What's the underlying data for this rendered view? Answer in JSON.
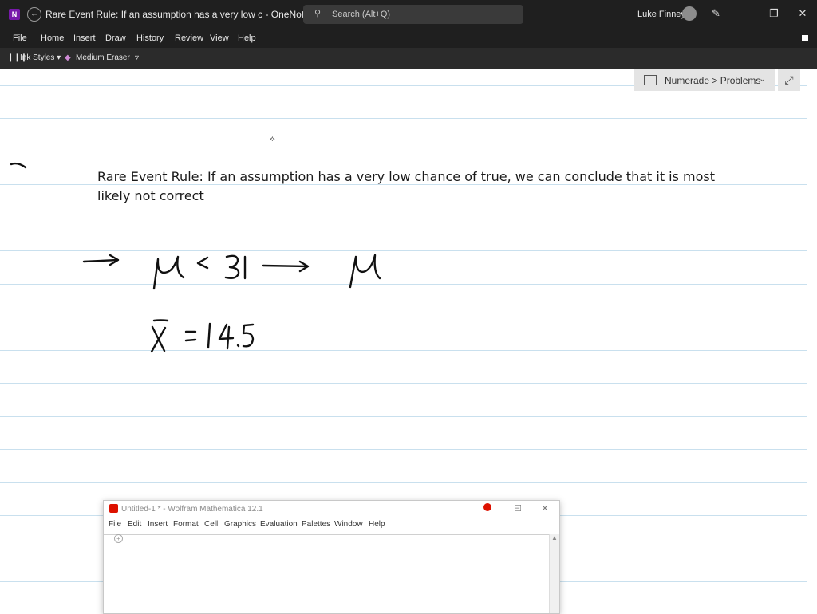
{
  "titlebar": {
    "app_logo": "N",
    "page_title": "Rare Event Rule: If an assumption has a very low c  -  OneNote",
    "search_placeholder": "Search (Alt+Q)",
    "user_name": "Luke Finney",
    "icons": [
      "onenote-icon",
      "back-icon",
      "search-icon",
      "avatar",
      "pen-icon",
      "minimize-icon",
      "restore-icon",
      "close-icon"
    ]
  },
  "menu": {
    "items": [
      "File",
      "Home",
      "Insert",
      "Draw",
      "History",
      "Review",
      "View",
      "Help"
    ]
  },
  "ribbon": {
    "ink_styles": "Ink Styles",
    "eraser": "Medium Eraser"
  },
  "notebook": {
    "breadcrumb": "Numerade > Problems"
  },
  "note": {
    "text": "Rare Event Rule: If an assumption has a very low chance of true, we can conclude that it is most likely not correct"
  },
  "mathematica": {
    "title": "Untitled-1 * - Wolfram Mathematica 12.1",
    "menu": [
      "File",
      "Edit",
      "Insert",
      "Format",
      "Cell",
      "Graphics",
      "Evaluation",
      "Palettes",
      "Window",
      "Help"
    ]
  },
  "colors": {
    "titlebar_bg": "#1f1f1f",
    "ribbon_bg": "#2b2b2b",
    "rule_line": "#c9e0ee",
    "onenote_purple": "#7719aa",
    "wolfram_red": "#dd1100"
  }
}
